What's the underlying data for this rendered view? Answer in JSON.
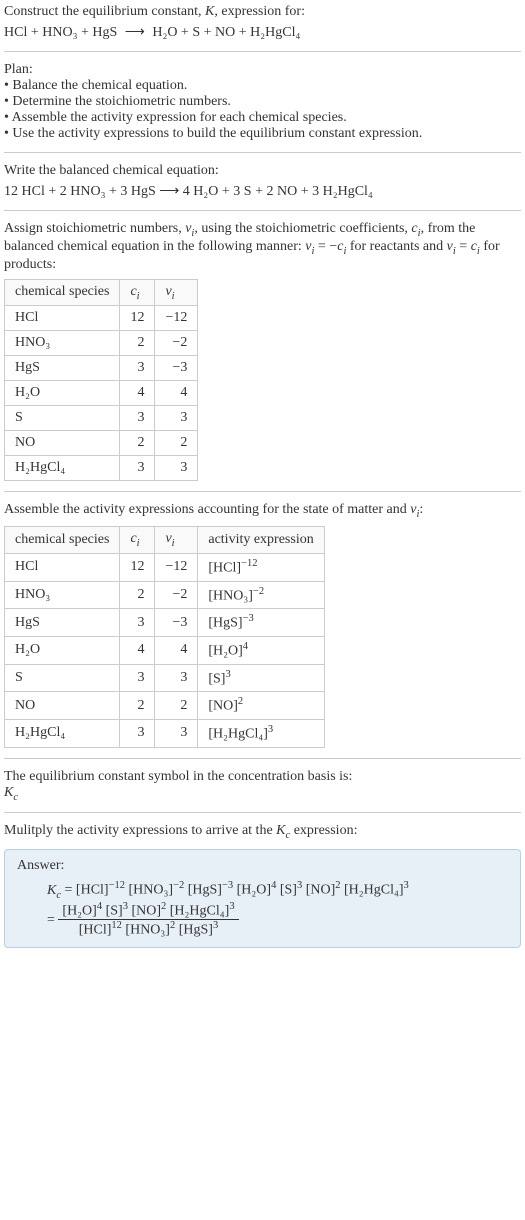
{
  "intro": {
    "prompt": "Construct the equilibrium constant, K, expression for:",
    "equation_lhs": "HCl + HNO₃ + HgS",
    "arrow": "⟶",
    "equation_rhs": "H₂O + S + NO + H₂HgCl₄"
  },
  "plan": {
    "heading": "Plan:",
    "bullets": [
      "• Balance the chemical equation.",
      "• Determine the stoichiometric numbers.",
      "• Assemble the activity expression for each chemical species.",
      "• Use the activity expressions to build the equilibrium constant expression."
    ]
  },
  "balanced": {
    "heading": "Write the balanced chemical equation:",
    "equation": "12 HCl + 2 HNO₃ + 3 HgS  ⟶  4 H₂O + 3 S + 2 NO + 3 H₂HgCl₄"
  },
  "stoich": {
    "intro1": "Assign stoichiometric numbers, νᵢ, using the stoichiometric coefficients, cᵢ, from the balanced chemical equation in the following manner: νᵢ = −cᵢ for reactants and νᵢ = cᵢ for products:",
    "headers": [
      "chemical species",
      "cᵢ",
      "νᵢ"
    ],
    "rows": [
      {
        "species": "HCl",
        "ci": "12",
        "vi": "−12"
      },
      {
        "species": "HNO₃",
        "ci": "2",
        "vi": "−2"
      },
      {
        "species": "HgS",
        "ci": "3",
        "vi": "−3"
      },
      {
        "species": "H₂O",
        "ci": "4",
        "vi": "4"
      },
      {
        "species": "S",
        "ci": "3",
        "vi": "3"
      },
      {
        "species": "NO",
        "ci": "2",
        "vi": "2"
      },
      {
        "species": "H₂HgCl₄",
        "ci": "3",
        "vi": "3"
      }
    ]
  },
  "activity": {
    "intro": "Assemble the activity expressions accounting for the state of matter and νᵢ:",
    "headers": [
      "chemical species",
      "cᵢ",
      "νᵢ",
      "activity expression"
    ],
    "rows": [
      {
        "species": "HCl",
        "ci": "12",
        "vi": "−12",
        "base": "[HCl]",
        "exp": "−12"
      },
      {
        "species": "HNO₃",
        "ci": "2",
        "vi": "−2",
        "base": "[HNO₃]",
        "exp": "−2"
      },
      {
        "species": "HgS",
        "ci": "3",
        "vi": "−3",
        "base": "[HgS]",
        "exp": "−3"
      },
      {
        "species": "H₂O",
        "ci": "4",
        "vi": "4",
        "base": "[H₂O]",
        "exp": "4"
      },
      {
        "species": "S",
        "ci": "3",
        "vi": "3",
        "base": "[S]",
        "exp": "3"
      },
      {
        "species": "NO",
        "ci": "2",
        "vi": "2",
        "base": "[NO]",
        "exp": "2"
      },
      {
        "species": "H₂HgCl₄",
        "ci": "3",
        "vi": "3",
        "base": "[H₂HgCl₄]",
        "exp": "3"
      }
    ]
  },
  "kc_symbol": {
    "line1": "The equilibrium constant symbol in the concentration basis is:",
    "symbol": "K_c"
  },
  "multiply": {
    "text": "Mulitply the activity expressions to arrive at the K_c expression:"
  },
  "answer": {
    "label": "Answer:",
    "kc": "K_c",
    "eq": "=",
    "line1_terms": [
      {
        "base": "[HCl]",
        "exp": "−12"
      },
      {
        "base": "[HNO₃]",
        "exp": "−2"
      },
      {
        "base": "[HgS]",
        "exp": "−3"
      },
      {
        "base": "[H₂O]",
        "exp": "4"
      },
      {
        "base": "[S]",
        "exp": "3"
      },
      {
        "base": "[NO]",
        "exp": "2"
      },
      {
        "base": "[H₂HgCl₄]",
        "exp": "3"
      }
    ],
    "frac_num": [
      {
        "base": "[H₂O]",
        "exp": "4"
      },
      {
        "base": "[S]",
        "exp": "3"
      },
      {
        "base": "[NO]",
        "exp": "2"
      },
      {
        "base": "[H₂HgCl₄]",
        "exp": "3"
      }
    ],
    "frac_den": [
      {
        "base": "[HCl]",
        "exp": "12"
      },
      {
        "base": "[HNO₃]",
        "exp": "2"
      },
      {
        "base": "[HgS]",
        "exp": "3"
      }
    ]
  }
}
